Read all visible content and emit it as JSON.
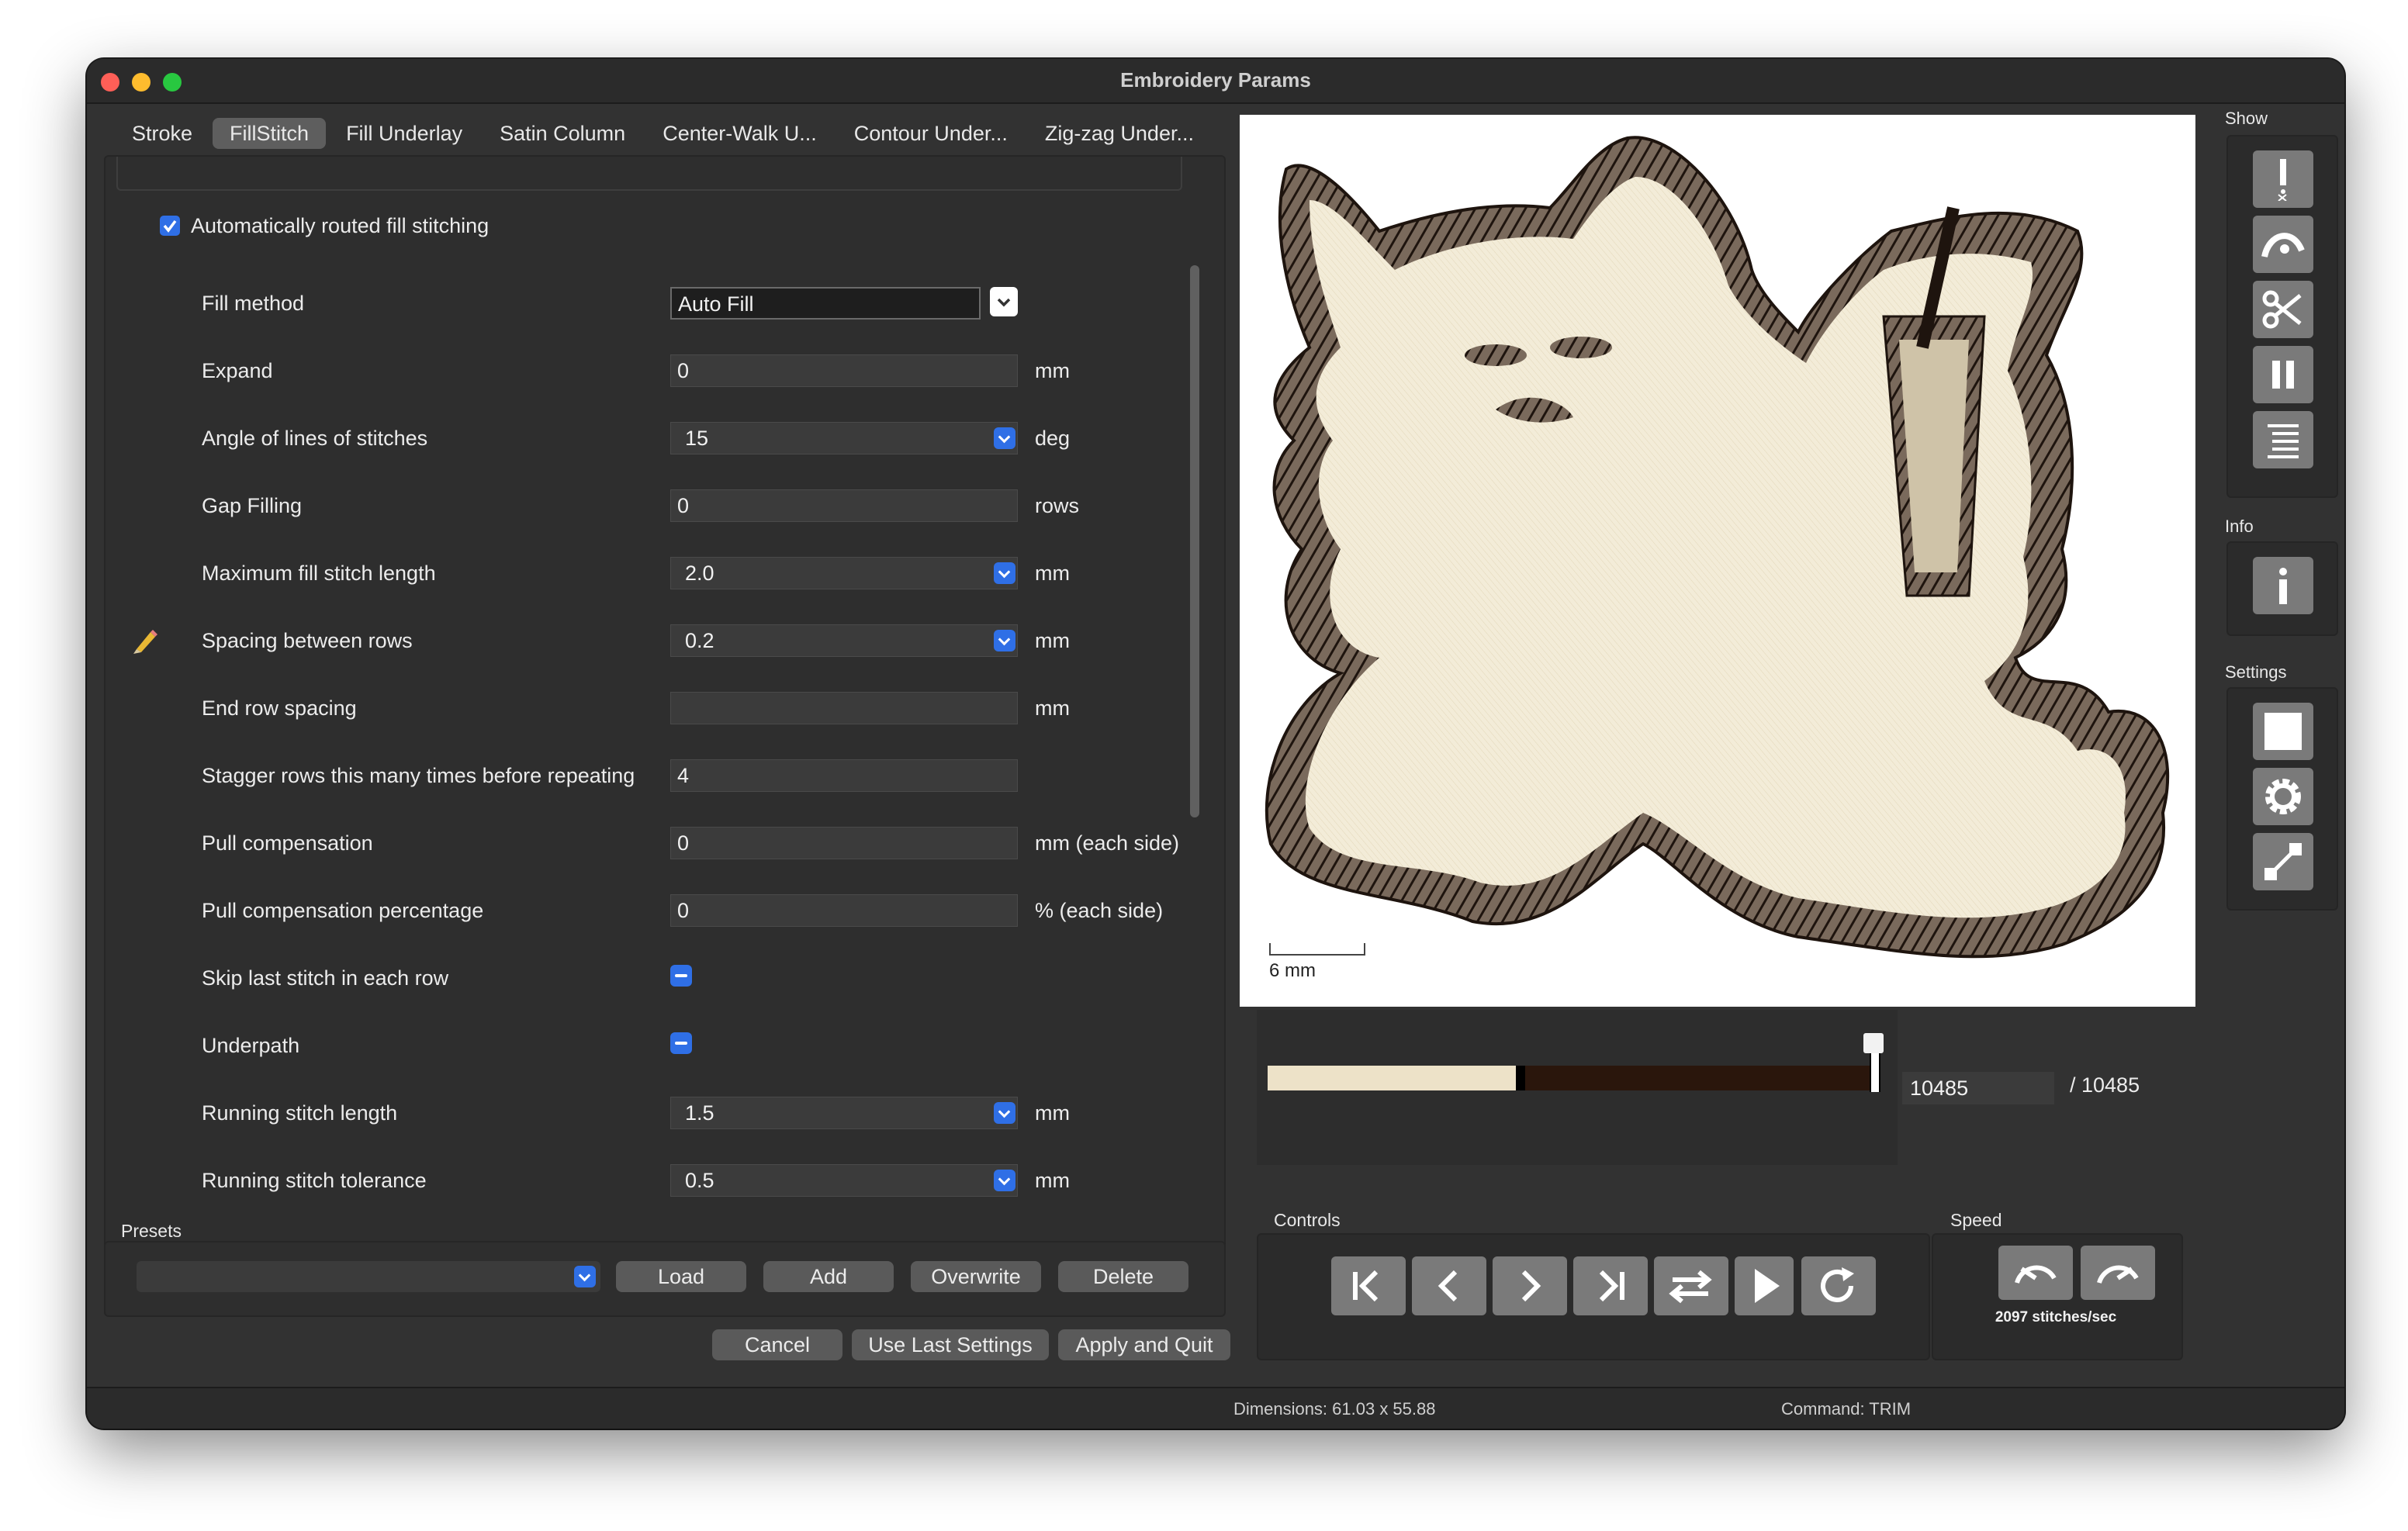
{
  "window": {
    "title": "Embroidery Params"
  },
  "tabs": [
    "Stroke",
    "FillStitch",
    "Fill Underlay",
    "Satin Column",
    "Center-Walk U...",
    "Contour Under...",
    "Zig-zag Under..."
  ],
  "params": {
    "auto_route_label": "Automatically routed fill stitching",
    "fill_method": {
      "label": "Fill method",
      "value": "Auto Fill"
    },
    "expand": {
      "label": "Expand",
      "value": "0",
      "unit": "mm"
    },
    "angle": {
      "label": "Angle of lines of stitches",
      "value": "15",
      "unit": "deg"
    },
    "gap": {
      "label": "Gap Filling",
      "value": "0",
      "unit": "rows"
    },
    "max_len": {
      "label": "Maximum fill stitch length",
      "value": "2.0",
      "unit": "mm"
    },
    "spacing": {
      "label": "Spacing between rows",
      "value": "0.2",
      "unit": "mm"
    },
    "end_row": {
      "label": "End row spacing",
      "value": "",
      "unit": "mm"
    },
    "stagger": {
      "label": "Stagger rows this many times before repeating",
      "value": "4"
    },
    "pull_comp": {
      "label": "Pull compensation",
      "value": "0",
      "unit": "mm (each side)"
    },
    "pull_pct": {
      "label": "Pull compensation percentage",
      "value": "0",
      "unit": "% (each side)"
    },
    "skip_last": {
      "label": "Skip last stitch in each row"
    },
    "underpath": {
      "label": "Underpath"
    },
    "run_len": {
      "label": "Running stitch length",
      "value": "1.5",
      "unit": "mm"
    },
    "run_tol": {
      "label": "Running stitch tolerance",
      "value": "0.5",
      "unit": "mm"
    }
  },
  "presets": {
    "label": "Presets",
    "load": "Load",
    "add": "Add",
    "overwrite": "Overwrite",
    "delete": "Delete"
  },
  "footer": {
    "cancel": "Cancel",
    "use_last": "Use Last Settings",
    "apply": "Apply and Quit"
  },
  "preview": {
    "scale_label": "6 mm",
    "current_stitch": "10485",
    "total_stitch": "/ 10485",
    "progress_fraction": 1.0
  },
  "controls": {
    "label": "Controls"
  },
  "speed": {
    "label": "Speed",
    "value": "2097 stitches/sec"
  },
  "sidebar": {
    "show_label": "Show",
    "info_label": "Info",
    "settings_label": "Settings"
  },
  "status": {
    "dimensions": "Dimensions: 61.03 x 55.88",
    "command": "Command: TRIM"
  },
  "colors": {
    "thread_light": "#ede2c8",
    "thread_dark": "#2a160c",
    "accent": "#2f6fe6"
  }
}
